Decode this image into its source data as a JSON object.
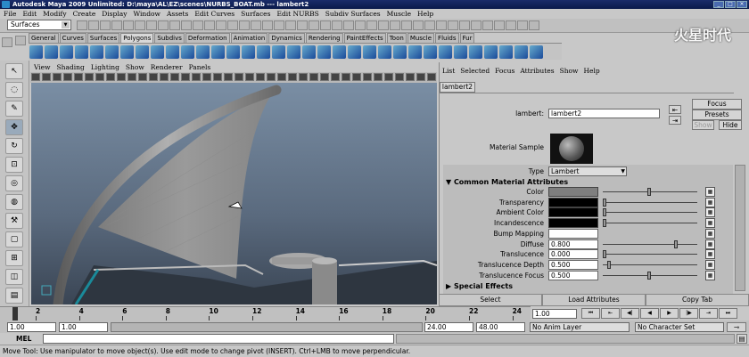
{
  "window": {
    "title": "Autodesk Maya 2009 Unlimited: D:\\maya\\AL\\EZ\\scenes\\NURBS_BOAT.mb  ---  lambert2"
  },
  "menubar": [
    "File",
    "Edit",
    "Modify",
    "Create",
    "Display",
    "Window",
    "Assets",
    "Edit Curves",
    "Surfaces",
    "Edit NURBS",
    "Subdiv Surfaces",
    "Muscle",
    "Help"
  ],
  "status": {
    "mode": "Surfaces"
  },
  "shelf_tabs": [
    {
      "label": "General"
    },
    {
      "label": "Curves"
    },
    {
      "label": "Surfaces"
    },
    {
      "label": "Polygons"
    },
    {
      "label": "Subdivs"
    },
    {
      "label": "Deformation"
    },
    {
      "label": "Animation"
    },
    {
      "label": "Dynamics"
    },
    {
      "label": "Rendering"
    },
    {
      "label": "PaintEffects"
    },
    {
      "label": "Toon"
    },
    {
      "label": "Muscle"
    },
    {
      "label": "Fluids"
    },
    {
      "label": "Fur"
    }
  ],
  "panel_menu": [
    "View",
    "Shading",
    "Lighting",
    "Show",
    "Renderer",
    "Panels"
  ],
  "ae": {
    "menu": [
      "List",
      "Selected",
      "Focus",
      "Attributes",
      "Show",
      "Help"
    ],
    "tab": "lambert2",
    "name_label": "lambert:",
    "name_value": "lambert2",
    "focus_btn": "Focus",
    "presets_btn": "Presets",
    "show_btn": "Show",
    "hide_btn": "Hide",
    "material_sample_label": "Material Sample",
    "type_label": "Type",
    "type_value": "Lambert",
    "section_common": "Common Material Attributes",
    "section_special": "Special Effects",
    "attrs": [
      {
        "label": "Color",
        "kind": "swatch",
        "color": "#7f7f7f",
        "level": 0.5
      },
      {
        "label": "Transparency",
        "kind": "swatch",
        "color": "#000000",
        "level": 0.0
      },
      {
        "label": "Ambient Color",
        "kind": "swatch",
        "color": "#000000",
        "level": 0.0
      },
      {
        "label": "Incandescence",
        "kind": "swatch",
        "color": "#000000",
        "level": 0.0
      },
      {
        "label": "Bump Mapping",
        "kind": "bump"
      },
      {
        "label": "Diffuse",
        "kind": "value",
        "value": "0.800",
        "level": 0.8
      },
      {
        "label": "Translucence",
        "kind": "value",
        "value": "0.000",
        "level": 0.0
      },
      {
        "label": "Translucence Depth",
        "kind": "value",
        "value": "0.500",
        "level": 0.05
      },
      {
        "label": "Translucence Focus",
        "kind": "value",
        "value": "0.500",
        "level": 0.5
      }
    ],
    "select_btn": "Select",
    "load_btn": "Load Attributes",
    "copy_btn": "Copy Tab"
  },
  "timeline": {
    "ticks": [
      "2",
      "4",
      "6",
      "8",
      "10",
      "12",
      "14",
      "16",
      "18",
      "20",
      "22",
      "24"
    ],
    "current": "1.00"
  },
  "range": {
    "start": "1.00",
    "start2": "1.00",
    "end": "24.00",
    "end2": "48.00",
    "anim_layer": "No Anim Layer",
    "char_set": "No Character Set"
  },
  "mel": {
    "label": "MEL"
  },
  "help": {
    "text": "Move Tool: Use manipulator to move object(s). Use edit mode to change pivot (INSERT). Ctrl+LMB to move perpendicular."
  },
  "watermark": "火星时代"
}
